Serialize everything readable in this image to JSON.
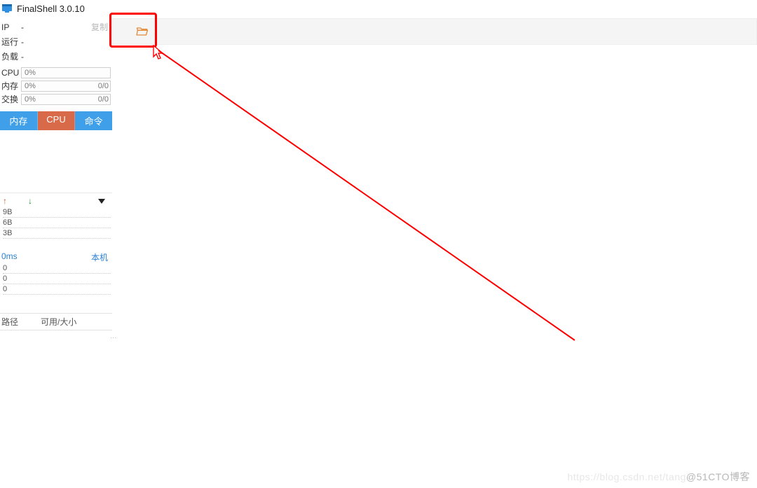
{
  "titlebar": {
    "title": "FinalShell 3.0.10"
  },
  "sidebar": {
    "info": {
      "ip_label": "IP",
      "ip_value": "-",
      "run_label": "运行",
      "run_value": "-",
      "load_label": "负载",
      "load_value": "-",
      "copy_label": "复制"
    },
    "meters": {
      "cpu": {
        "label": "CPU",
        "pct": "0%",
        "right": ""
      },
      "mem": {
        "label": "内存",
        "pct": "0%",
        "right": "0/0"
      },
      "swap": {
        "label": "交换",
        "pct": "0%",
        "right": "0/0"
      }
    },
    "tabs": {
      "mem": "内存",
      "cpu": "CPU",
      "cmd": "命令"
    },
    "net": {
      "up_icon": "↑",
      "down_icon": "↓",
      "ticks": [
        "9B",
        "6B",
        "3B"
      ]
    },
    "ping": {
      "ms": "0ms",
      "host": "本机",
      "ticks": [
        "0",
        "0",
        "0"
      ]
    },
    "disk": {
      "col1": "路径",
      "col2": "可用/大小"
    }
  },
  "watermark": {
    "faint": "https://blog.csdn.net/tang",
    "tag": "@51CTO博客"
  }
}
